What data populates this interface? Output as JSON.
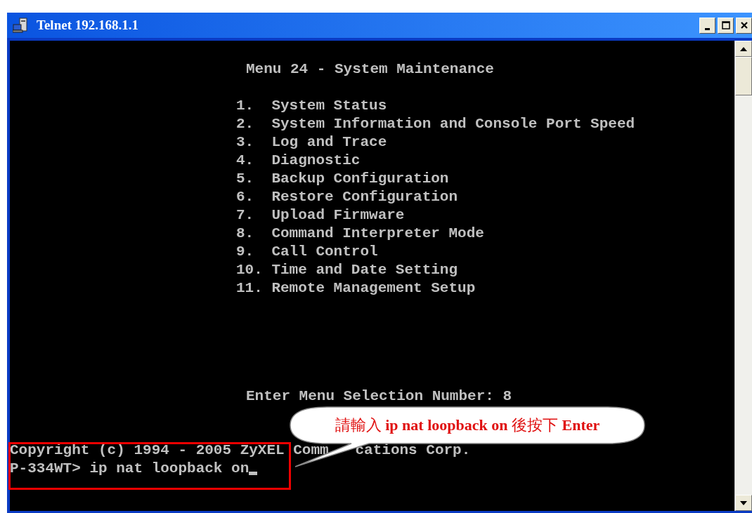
{
  "window": {
    "title": "Telnet 192.168.1.1"
  },
  "terminal": {
    "heading": "Menu 24 - System Maintenance",
    "menu": [
      {
        "number": "1.",
        "label": "System Status"
      },
      {
        "number": "2.",
        "label": "System Information and Console Port Speed"
      },
      {
        "number": "3.",
        "label": "Log and Trace"
      },
      {
        "number": "4.",
        "label": "Diagnostic"
      },
      {
        "number": "5.",
        "label": "Backup Configuration"
      },
      {
        "number": "6.",
        "label": "Restore Configuration"
      },
      {
        "number": "7.",
        "label": "Upload Firmware"
      },
      {
        "number": "8.",
        "label": "Command Interpreter Mode"
      },
      {
        "number": "9.",
        "label": "Call Control"
      },
      {
        "number": "10.",
        "label": "Time and Date Setting"
      },
      {
        "number": "11.",
        "label": "Remote Management Setup"
      }
    ],
    "selection_prompt": "Enter Menu Selection Number: 8",
    "copyright_parts": [
      "Copyright (c) 1994 - 2005 ZyXEL Comm",
      "cations Corp."
    ],
    "command_line": "P-334WT> ip nat loopback on"
  },
  "callout": {
    "text": "請輸入 **ip nat loopback on** 後按下 **Enter**"
  }
}
